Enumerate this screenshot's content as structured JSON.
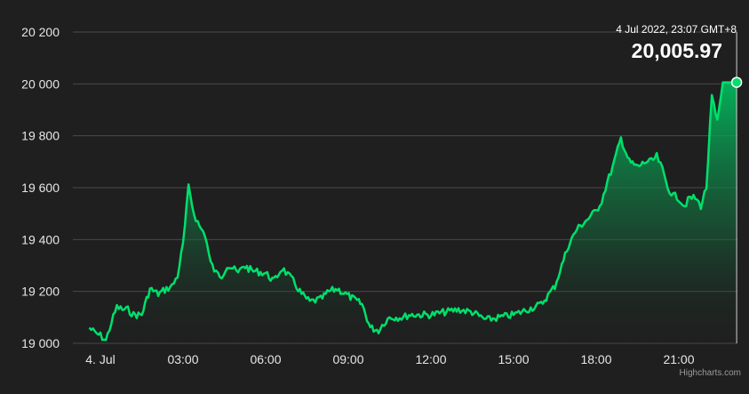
{
  "chart_data": {
    "type": "area",
    "ylim": [
      19000,
      20200
    ],
    "y_ticks": [
      "19 000",
      "19 200",
      "19 400",
      "19 600",
      "19 800",
      "20 000",
      "20 200"
    ],
    "x_ticks": [
      "4. Jul",
      "03:00",
      "06:00",
      "09:00",
      "12:00",
      "15:00",
      "18:00",
      "21:00"
    ],
    "x_tick_hours": [
      0,
      3,
      6,
      9,
      12,
      15,
      18,
      21
    ],
    "grid": "horizontal",
    "series": [
      {
        "color": "#00e06b",
        "x_hours": [
          -0.4,
          -0.2,
          0,
          0.2,
          0.4,
          0.6,
          0.8,
          1.0,
          1.2,
          1.5,
          1.8,
          2.1,
          2.4,
          2.6,
          2.8,
          3.0,
          3.2,
          3.4,
          3.6,
          3.8,
          4.0,
          4.2,
          4.4,
          4.6,
          4.8,
          5.0,
          5.2,
          5.5,
          6.0,
          6.3,
          6.6,
          7.0,
          7.3,
          7.6,
          8.0,
          8.3,
          8.6,
          8.9,
          9.2,
          9.5,
          9.8,
          10.1,
          10.3,
          10.5,
          10.8,
          11.0,
          11.2,
          11.5,
          12.0,
          12.5,
          13.0,
          13.5,
          14.0,
          14.5,
          15.0,
          15.5,
          16.0,
          16.5,
          17.0,
          17.3,
          17.6,
          17.8,
          18.0,
          18.2,
          18.4,
          18.6,
          18.9,
          19.2,
          19.5,
          19.8,
          20.0,
          20.2,
          20.4,
          20.6,
          20.8,
          21.0,
          21.2,
          21.4,
          21.6,
          21.8,
          22.0,
          22.2,
          22.4,
          22.6,
          22.8,
          23.0,
          23.1
        ],
        "values": [
          19060,
          19040,
          19030,
          19010,
          19080,
          19140,
          19130,
          19130,
          19110,
          19110,
          19210,
          19190,
          19210,
          19220,
          19260,
          19380,
          19600,
          19500,
          19450,
          19420,
          19310,
          19270,
          19260,
          19300,
          19290,
          19270,
          19300,
          19280,
          19270,
          19240,
          19290,
          19240,
          19190,
          19160,
          19170,
          19200,
          19210,
          19190,
          19170,
          19150,
          19060,
          19050,
          19080,
          19100,
          19100,
          19100,
          19110,
          19110,
          19110,
          19120,
          19130,
          19120,
          19090,
          19100,
          19110,
          19130,
          19150,
          19220,
          19380,
          19440,
          19470,
          19490,
          19510,
          19550,
          19620,
          19680,
          19790,
          19700,
          19680,
          19700,
          19700,
          19720,
          19670,
          19600,
          19570,
          19560,
          19530,
          19560,
          19560,
          19530,
          19600,
          19950,
          19850,
          20005.97,
          20005.97,
          20005.97,
          20005.97
        ]
      }
    ]
  },
  "tooltip": {
    "date": "4 Jul 2022, 23:07 GMT+8",
    "value": "20,005.97"
  },
  "credits": "Highcharts.com"
}
